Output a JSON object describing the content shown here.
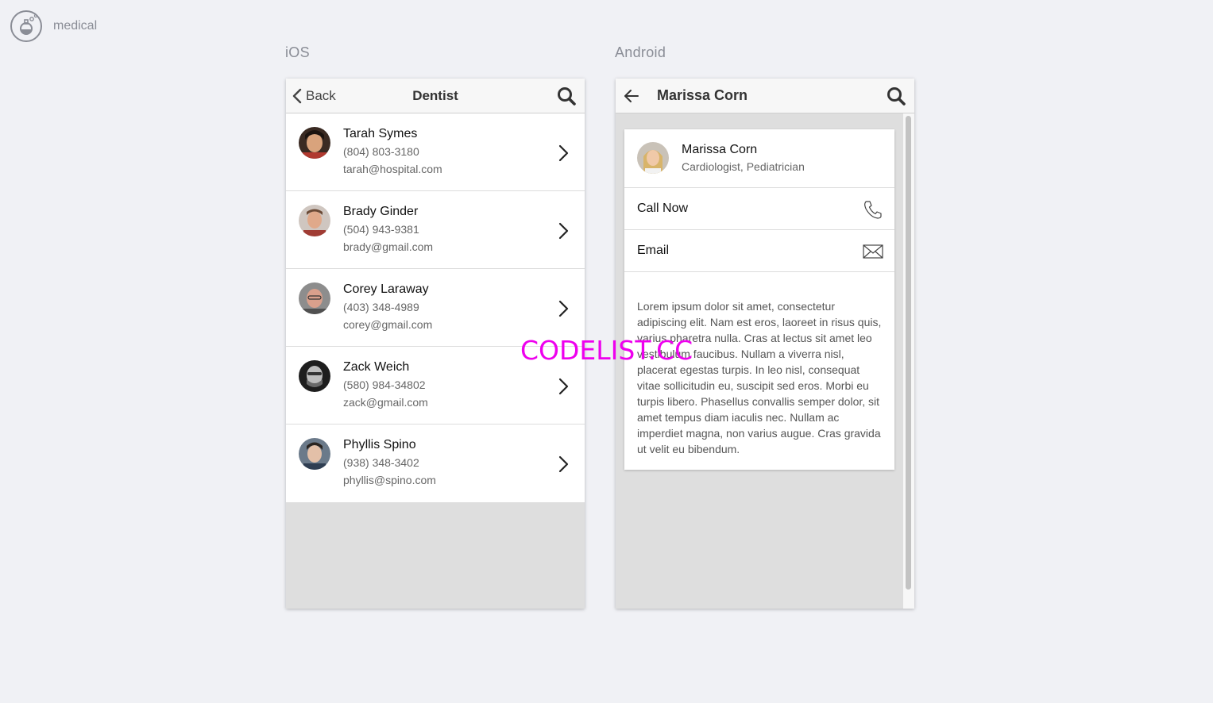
{
  "brand": {
    "label": "medical",
    "icon": "flask-icon"
  },
  "ios": {
    "platform_label": "iOS",
    "back_label": "Back",
    "title": "Dentist",
    "contacts": [
      {
        "name": "Tarah Symes",
        "phone": "(804) 803-3180",
        "email": "tarah@hospital.com"
      },
      {
        "name": "Brady Ginder",
        "phone": "(504) 943-9381",
        "email": "brady@gmail.com"
      },
      {
        "name": "Corey Laraway",
        "phone": "(403) 348-4989",
        "email": "corey@gmail.com"
      },
      {
        "name": "Zack Weich",
        "phone": "(580) 984-34802",
        "email": "zack@gmail.com"
      },
      {
        "name": "Phyllis Spino",
        "phone": "(938) 348-3402",
        "email": "phyllis@spino.com"
      }
    ]
  },
  "android": {
    "platform_label": "Android",
    "title": "Marissa Corn",
    "profile": {
      "name": "Marissa Corn",
      "role": "Cardiologist, Pediatrician"
    },
    "actions": [
      {
        "label": "Call Now",
        "icon": "phone-icon"
      },
      {
        "label": "Email",
        "icon": "envelope-icon"
      }
    ],
    "bio": "Lorem ipsum dolor sit amet, consectetur adipiscing elit. Nam est eros, laoreet in risus quis, varius pharetra nulla. Cras at lectus sit amet leo vestibulum faucibus. Nullam a viverra nisl, placerat egestas turpis. In leo nisl, consequat vitae sollicitudin eu, suscipit sed eros. Morbi eu turpis libero. Phasellus convallis semper dolor, sit amet tempus diam iaculis nec. Nullam ac imperdiet magna, non varius augue. Cras gravida ut velit eu bibendum."
  },
  "watermark": "CODELIST.CC",
  "colors": {
    "background": "#f0f1f5",
    "toolbar": "#f7f7f7",
    "empty_area": "#dedede",
    "watermark": "#ee00ee"
  }
}
